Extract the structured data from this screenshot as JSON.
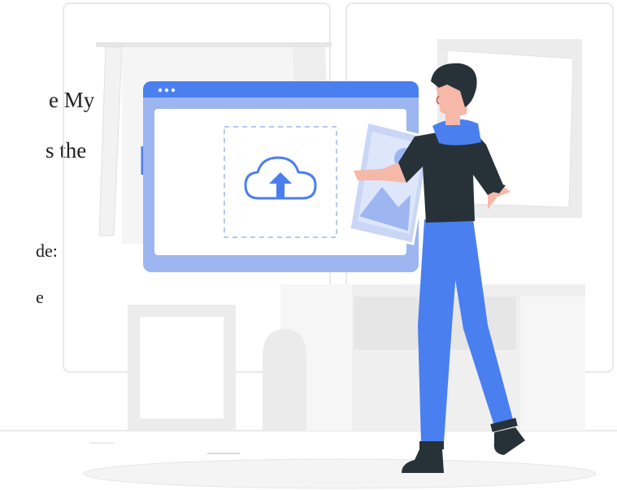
{
  "text_fragments": {
    "line1": "e  My",
    "line2": "s  the",
    "line3": "de:",
    "line4": "e"
  },
  "illustration": {
    "subject": "person uploading image to cloud",
    "colors": {
      "accent_blue": "#4a7ff0",
      "panel_light_blue": "#dde6fb",
      "window_frame": "#9db6f2",
      "shirt": "#263238",
      "hair": "#263238",
      "skin": "#f6b8a8",
      "background_shapes": "#ededed",
      "background_lines": "#d9d9d9"
    },
    "icons": [
      "upload-cloud-icon",
      "image-photo-icon",
      "window-dots-icon"
    ]
  }
}
